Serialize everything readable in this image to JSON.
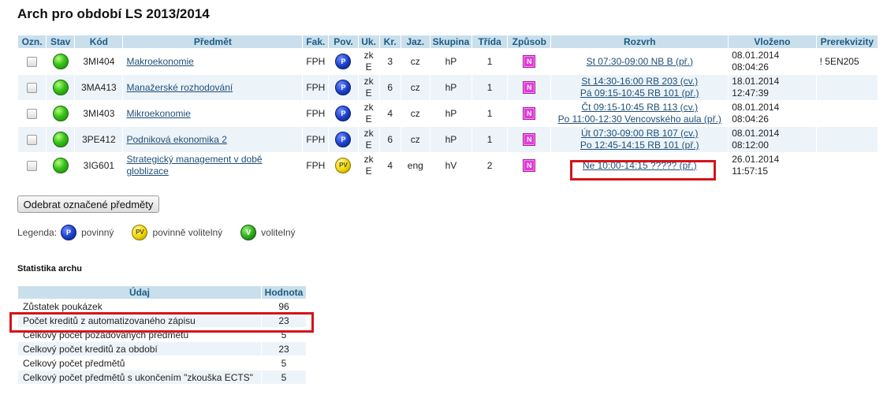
{
  "page": {
    "title": "Arch pro období LS 2013/2014"
  },
  "table": {
    "headers": [
      "Ozn.",
      "Stav",
      "Kód",
      "Předmět",
      "Fak.",
      "Pov.",
      "Uk.",
      "Kr.",
      "Jaz.",
      "Skupina",
      "Třída",
      "Způsob",
      "Rozvrh",
      "Vloženo",
      "Prerekvizity"
    ],
    "rows": [
      {
        "kod": "3MI404",
        "predmet": "Makroekonomie",
        "fak": "FPH",
        "pov": "P",
        "uk1": "zk",
        "uk2": "E",
        "kr": "3",
        "jaz": "cz",
        "skupina": "hP",
        "trida": "1",
        "zpusob": "N",
        "rozvrh1": "St 07:30-09:00 NB B (př.)",
        "rozvrh2": "",
        "vlozeno1": "08.01.2014",
        "vlozeno2": "08:04:26",
        "prerekvizity": "! 5EN205"
      },
      {
        "kod": "3MA413",
        "predmet": "Manažerské rozhodování",
        "fak": "FPH",
        "pov": "P",
        "uk1": "zk",
        "uk2": "E",
        "kr": "6",
        "jaz": "cz",
        "skupina": "hP",
        "trida": "1",
        "zpusob": "N",
        "rozvrh1": "St 14:30-16:00 RB 203 (cv.)",
        "rozvrh2": "Pá 09:15-10:45 RB 101 (př.)",
        "vlozeno1": "18.01.2014",
        "vlozeno2": "12:47:39",
        "prerekvizity": ""
      },
      {
        "kod": "3MI403",
        "predmet": "Mikroekonomie",
        "fak": "FPH",
        "pov": "P",
        "uk1": "zk",
        "uk2": "E",
        "kr": "4",
        "jaz": "cz",
        "skupina": "hP",
        "trida": "1",
        "zpusob": "N",
        "rozvrh1": "Čt 09:15-10:45 RB 113 (cv.)",
        "rozvrh2": "Po 11:00-12:30 Vencovského aula (př.)",
        "vlozeno1": "08.01.2014",
        "vlozeno2": "08:04:26",
        "prerekvizity": ""
      },
      {
        "kod": "3PE412",
        "predmet": "Podniková ekonomika 2",
        "fak": "FPH",
        "pov": "P",
        "uk1": "zk",
        "uk2": "E",
        "kr": "6",
        "jaz": "cz",
        "skupina": "hP",
        "trida": "1",
        "zpusob": "N",
        "rozvrh1": "Út 07:30-09:00 RB 107 (cv.)",
        "rozvrh2": "Po 12:45-14:15 RB 101 (př.)",
        "vlozeno1": "08.01.2014",
        "vlozeno2": "08:12:00",
        "prerekvizity": ""
      },
      {
        "kod": "3IG601",
        "predmet": "Strategický management v době globlizace",
        "fak": "FPH",
        "pov": "PV",
        "uk1": "zk",
        "uk2": "E",
        "kr": "4",
        "jaz": "eng",
        "skupina": "hV",
        "trida": "2",
        "zpusob": "N",
        "rozvrh1": "Ne 10:00-14:15 ????? (př.)",
        "rozvrh2": "",
        "vlozeno1": "26.01.2014",
        "vlozeno2": "11:57:15",
        "prerekvizity": ""
      }
    ]
  },
  "actions": {
    "remove_label": "Odebrat označené předměty"
  },
  "legend": {
    "label": "Legenda:",
    "items": [
      {
        "symbol": "P",
        "text": "povinný"
      },
      {
        "symbol": "PV",
        "text": "povinně volitelný"
      },
      {
        "symbol": "V",
        "text": "volitelný"
      }
    ]
  },
  "stats": {
    "title": "Statistika archu",
    "headers": [
      "Údaj",
      "Hodnota"
    ],
    "rows": [
      {
        "label": "Zůstatek poukázek",
        "value": "96"
      },
      {
        "label": "Počet kreditů z automatizovaného zápisu",
        "value": "23"
      },
      {
        "label": "Celkový počet požadovaných předmětů",
        "value": "5"
      },
      {
        "label": "Celkový počet kreditů za období",
        "value": "23"
      },
      {
        "label": "Celkový počet předmětů",
        "value": "5"
      },
      {
        "label": "Celkový počet předmětů s ukončením \"zkouška ECTS\"",
        "value": "5"
      }
    ]
  },
  "colors": {
    "header_bg": "#c9dfec",
    "header_text": "#1d5b82",
    "row_alt": "#edf4f9",
    "highlight": "#d4141a",
    "link": "#1f4f78",
    "badge_n": "#e23ad9"
  }
}
